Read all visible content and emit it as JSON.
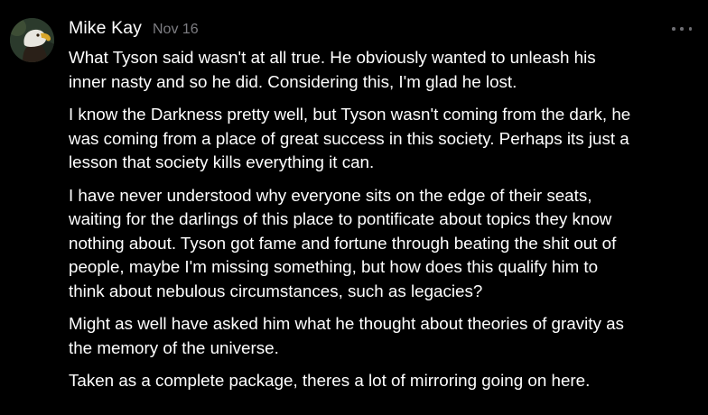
{
  "comment": {
    "author": "Mike Kay",
    "date": "Nov 16",
    "more_icon": "ellipsis-icon",
    "avatar_icon": "eagle-avatar",
    "paragraphs": [
      {
        "lines": [
          "What Tyson said wasn't at all true. He obviously wanted to unleash his",
          "inner nasty and so he did. Considering this, I'm glad he lost."
        ]
      },
      {
        "lines": [
          "I know the Darkness pretty well, but Tyson wasn't coming from the dark, he",
          "was coming from a place of great success in this society. Perhaps its just a",
          "lesson that society kills everything it can."
        ]
      },
      {
        "lines": [
          "I have never understood why everyone sits on the edge of their seats,",
          "waiting for the darlings of this place to pontificate about topics they know",
          "nothing about. Tyson got fame and fortune through beating the shit out of",
          "people, maybe I'm missing something, but how does this qualify him to",
          "think about nebulous circumstances, such as legacies?"
        ]
      },
      {
        "lines": [
          "Might as well have asked him what he thought about theories of gravity as",
          "the memory of the universe."
        ]
      },
      {
        "lines": [
          "Taken as a complete package, theres a lot of mirroring going on here."
        ]
      }
    ]
  },
  "colors": {
    "background": "#000000",
    "text": "#ffffff",
    "meta": "#7d7d82",
    "more_dots": "#6e6e73"
  }
}
